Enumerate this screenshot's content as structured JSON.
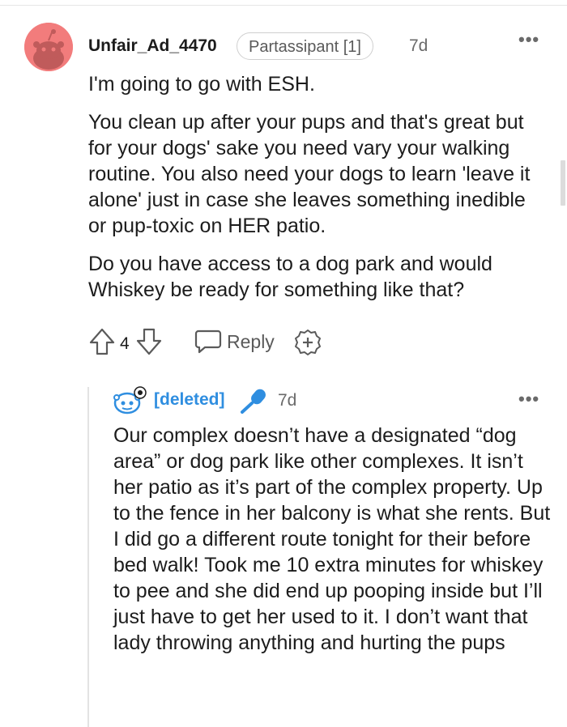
{
  "comment": {
    "author": "Unfair_Ad_4470",
    "flair": "Partassipant [1]",
    "age": "7d",
    "paragraphs": [
      "I'm going to go with ESH.",
      "You clean up after your pups and that's great but for your dogs' sake you need vary your walking routine. You also need your dogs to learn 'leave it alone' just in case she leaves something inedible or pup-toxic on HER patio.",
      "Do you have access to a dog park and would Whiskey be ready for something like that?"
    ],
    "vote_count": "4",
    "reply_label": "Reply"
  },
  "reply": {
    "author": "[deleted]",
    "age": "7d",
    "text": "Our complex doesn’t have a designated “dog area” or dog park like other complexes. It isn’t her patio as it’s part of the complex property. Up to the fence in her balcony is what she rents. But I did go a different route tonight for their before bed walk! Took me 10 extra minutes for whiskey to pee and she did end up pooping inside but I’ll just have to get her used to it. I don’t want that lady throwing anything and hurting the pups"
  },
  "colors": {
    "avatar_bg": "#f27c7c",
    "deleted_author": "#2f8ee0",
    "mic_icon": "#2f8ee0"
  },
  "icons": [
    "snoo-avatar",
    "overflow-menu-icon",
    "upvote-icon",
    "downvote-icon",
    "reply-icon",
    "award-icon",
    "deleted-user-avatar",
    "microphone-icon"
  ]
}
